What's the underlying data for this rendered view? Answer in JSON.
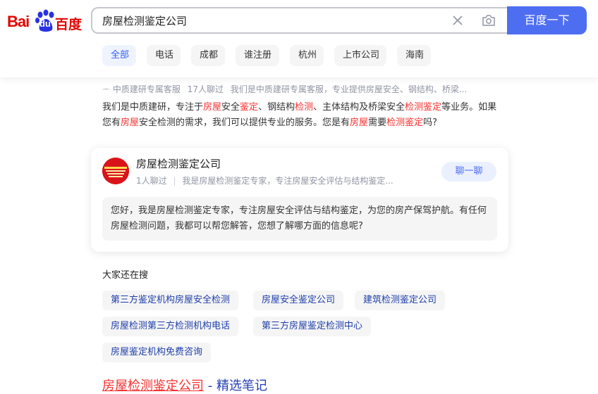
{
  "header": {
    "logo": {
      "part1": "Bai",
      "part2": "du",
      "part3": "百度"
    },
    "search": {
      "value": "房屋检测鉴定公司",
      "button_label": "百度一下"
    },
    "tabs": [
      {
        "label": "全部",
        "active": true
      },
      {
        "label": "电话"
      },
      {
        "label": "成都"
      },
      {
        "label": "谁注册"
      },
      {
        "label": "杭州"
      },
      {
        "label": "上市公司"
      },
      {
        "label": "海南"
      }
    ]
  },
  "source": {
    "name": "中质建研专属客服",
    "count": "17人聊过",
    "snippet": "我们是中质建研专属客服，专业提供房屋安全、钢结构、桥梁..."
  },
  "description": {
    "segments": [
      {
        "t": "我们是中质建研，专注于"
      },
      {
        "t": "房屋",
        "hl": true
      },
      {
        "t": "安全"
      },
      {
        "t": "鉴定",
        "hl": true
      },
      {
        "t": "、钢结构"
      },
      {
        "t": "检测",
        "hl": true
      },
      {
        "t": "、主体结构及桥梁安全"
      },
      {
        "t": "检测鉴定",
        "hl": true
      },
      {
        "t": "等业务。如果您有"
      },
      {
        "t": "房屋",
        "hl": true
      },
      {
        "t": "安全检测的需求，我们可以提供专业的服务。您是有"
      },
      {
        "t": "房屋",
        "hl": true
      },
      {
        "t": "需要"
      },
      {
        "t": "检测鉴定",
        "hl": true
      },
      {
        "t": "吗?"
      }
    ]
  },
  "chat": {
    "name": "房屋检测鉴定公司",
    "count": "1人聊过",
    "meta": "我是房屋检测鉴定专家，专注房屋安全评估与结构鉴定...",
    "button_label": "聊一聊",
    "message": "您好，我是房屋检测鉴定专家，专注房屋安全评估与结构鉴定，为您的房产保驾护航。有任何房屋检测问题，我都可以帮您解答，您想了解哪方面的信息呢?"
  },
  "related": {
    "title": "大家还在搜",
    "items": [
      "第三方鉴定机构房屋安全检测",
      "房屋安全鉴定公司",
      "建筑检测鉴定公司",
      "房屋检测第三方检测机构电话",
      "第三方房屋鉴定检测中心",
      "房屋鉴定机构免费咨询"
    ]
  },
  "result": {
    "title_red": "房屋检测鉴定公司",
    "title_rest": " - 精选笔记"
  },
  "colors": {
    "accent": "#4e6ef2",
    "highlight": "#f73131",
    "link": "#2440b3"
  }
}
